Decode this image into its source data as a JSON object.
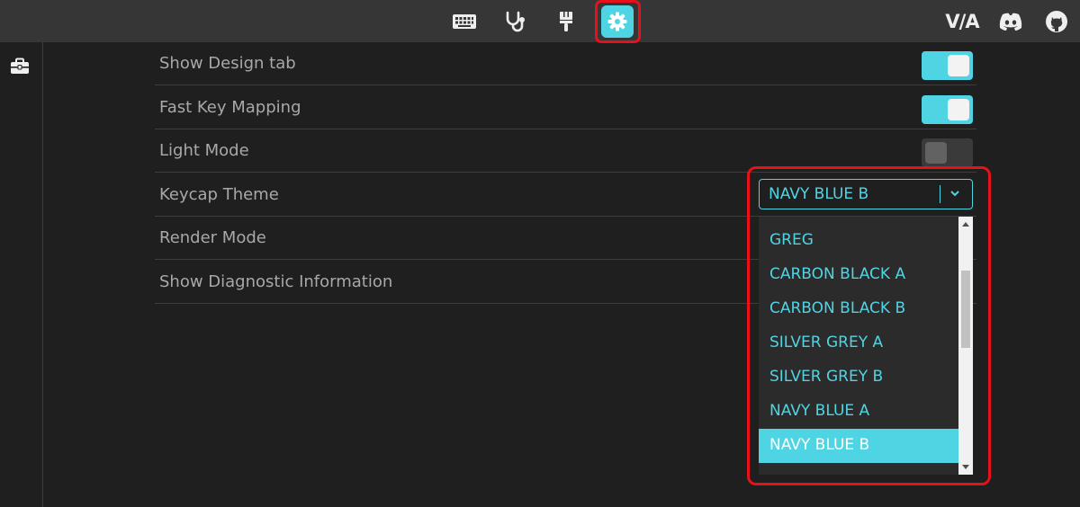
{
  "topbar": {
    "nav": [
      {
        "name": "keyboard-icon",
        "label": "Configure"
      },
      {
        "name": "stethoscope-icon",
        "label": "Test"
      },
      {
        "name": "paintbrush-icon",
        "label": "Design"
      },
      {
        "name": "gear-icon",
        "label": "Settings",
        "active": true
      }
    ],
    "logo_text": "V/A",
    "external": [
      {
        "name": "discord-icon"
      },
      {
        "name": "github-icon"
      }
    ]
  },
  "sidebar": {
    "items": [
      {
        "name": "toolbox-icon"
      }
    ]
  },
  "settings": {
    "rows": [
      {
        "label": "Show Design tab",
        "control": "toggle",
        "state": "on"
      },
      {
        "label": "Fast Key Mapping",
        "control": "toggle",
        "state": "on"
      },
      {
        "label": "Light Mode",
        "control": "toggle",
        "state": "off"
      },
      {
        "label": "Keycap Theme",
        "control": "select"
      },
      {
        "label": "Render Mode",
        "control": "none"
      },
      {
        "label": "Show Diagnostic Information",
        "control": "none"
      }
    ]
  },
  "keycap_theme": {
    "selected": "NAVY BLUE B",
    "visible_options": [
      "GREG",
      "CARBON BLACK A",
      "CARBON BLACK B",
      "SILVER GREY A",
      "SILVER GREY B",
      "NAVY BLUE A",
      "NAVY BLUE B"
    ]
  },
  "colors": {
    "accent": "#4fd4e4",
    "background": "#1f1f1f",
    "topbar": "#363636",
    "annotation": "#e8111a",
    "label": "#a8a8a8"
  }
}
